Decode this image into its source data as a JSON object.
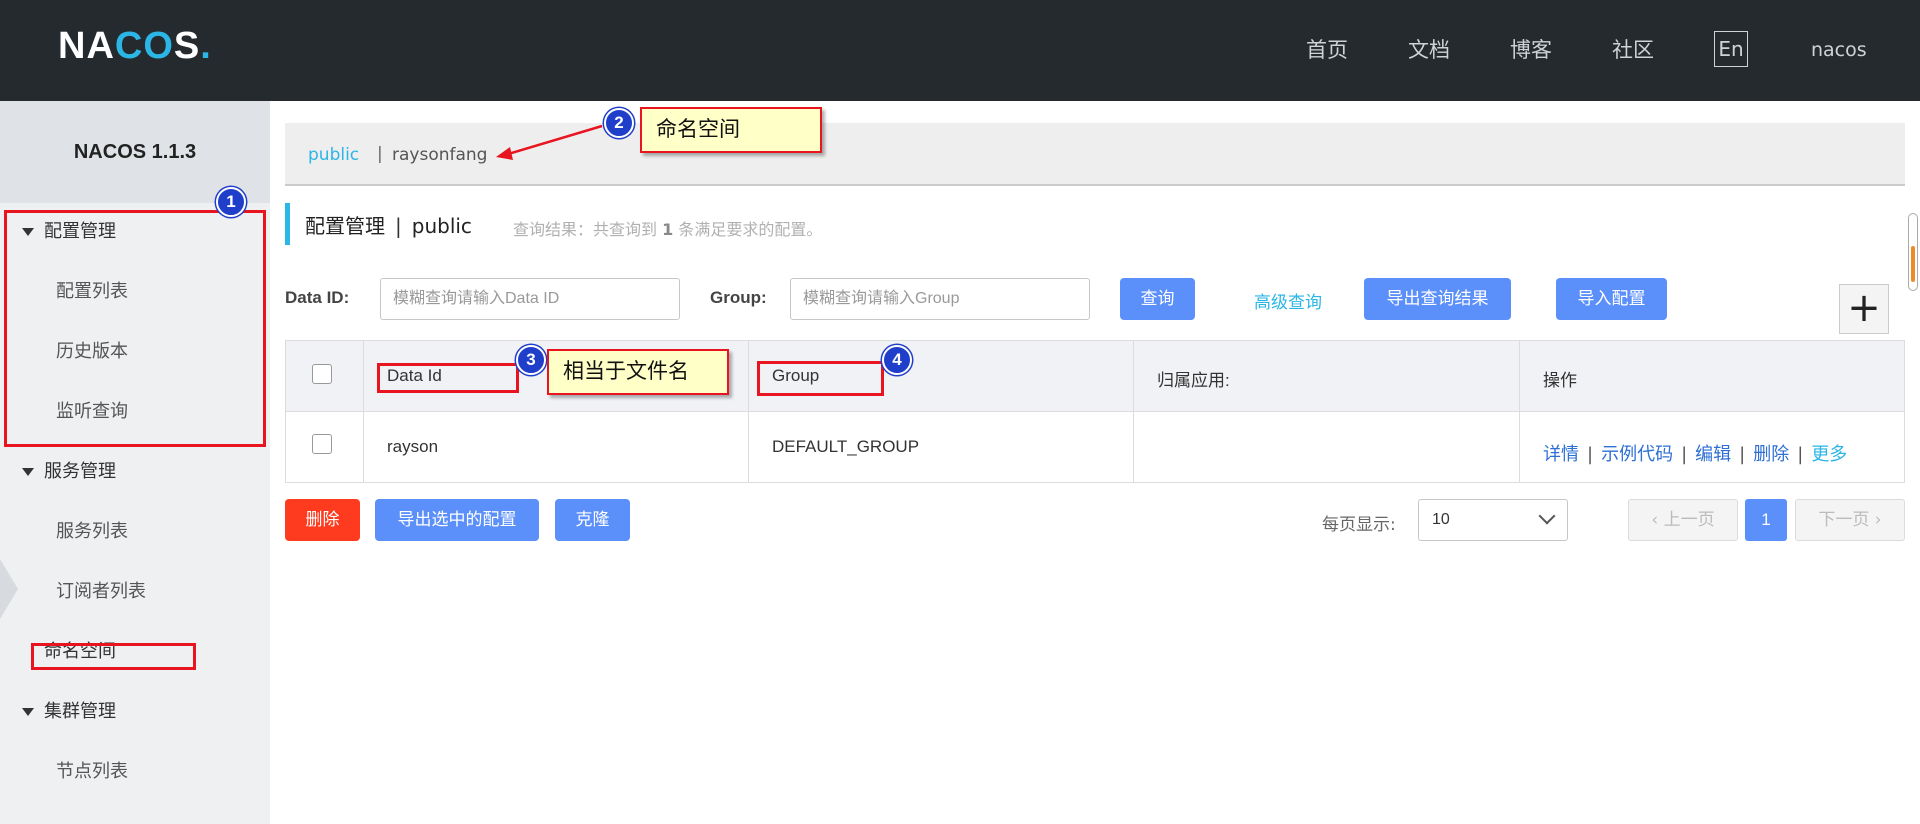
{
  "header": {
    "logo": {
      "n": "N",
      "a": "A",
      "c": "C",
      "o": "O",
      "s": "S",
      "dot": "."
    },
    "nav": [
      "首页",
      "文档",
      "博客",
      "社区"
    ],
    "lang": "En",
    "user": "nacos"
  },
  "sidebar": {
    "title": "NACOS 1.1.3",
    "groups": [
      {
        "label": "配置管理",
        "items": [
          "配置列表",
          "历史版本",
          "监听查询"
        ]
      },
      {
        "label": "服务管理",
        "items": [
          "服务列表",
          "订阅者列表",
          "命名空间"
        ]
      },
      {
        "label": "集群管理",
        "items": [
          "节点列表"
        ]
      }
    ]
  },
  "namespace_bar": {
    "active": "public",
    "separator": "|",
    "other": "raysonfang"
  },
  "page": {
    "title": "配置管理",
    "separator": "|",
    "namespace": "public",
    "result_prefix": "查询结果：共查询到",
    "result_count": "1",
    "result_suffix": "条满足要求的配置。"
  },
  "search": {
    "dataid_label": "Data ID:",
    "dataid_placeholder": "模糊查询请输入Data ID",
    "group_label": "Group:",
    "group_placeholder": "模糊查询请输入Group",
    "query_button": "查询",
    "advanced_link": "高级查询",
    "export_results_button": "导出查询结果",
    "import_button": "导入配置",
    "add_symbol": "+"
  },
  "table": {
    "columns": [
      "Data Id",
      "Group",
      "归属应用:",
      "操作"
    ],
    "rows": [
      {
        "data_id": "rayson",
        "group": "DEFAULT_GROUP",
        "app": "",
        "actions": [
          "详情",
          "示例代码",
          "编辑",
          "删除",
          "更多"
        ]
      }
    ],
    "action_separator": "|"
  },
  "bulk": {
    "delete_button": "删除",
    "export_selected_button": "导出选中的配置",
    "clone_button": "克隆"
  },
  "pagination": {
    "page_size_label": "每页显示:",
    "page_size": "10",
    "prev": "上一页",
    "current": "1",
    "next": "下一页"
  },
  "annotations": [
    {
      "number": "1"
    },
    {
      "number": "2",
      "text": "命名空间"
    },
    {
      "number": "3",
      "text": "相当于文件名"
    },
    {
      "number": "4"
    }
  ],
  "colors": {
    "header_bg": "#252a2f",
    "accent": "#2bb6e6",
    "primary": "#5b8ff9",
    "danger": "#ff3b1f",
    "annotation_red": "#e8141f",
    "annotation_blue": "#1f3ec9",
    "callout_bg": "#ffffc8"
  }
}
